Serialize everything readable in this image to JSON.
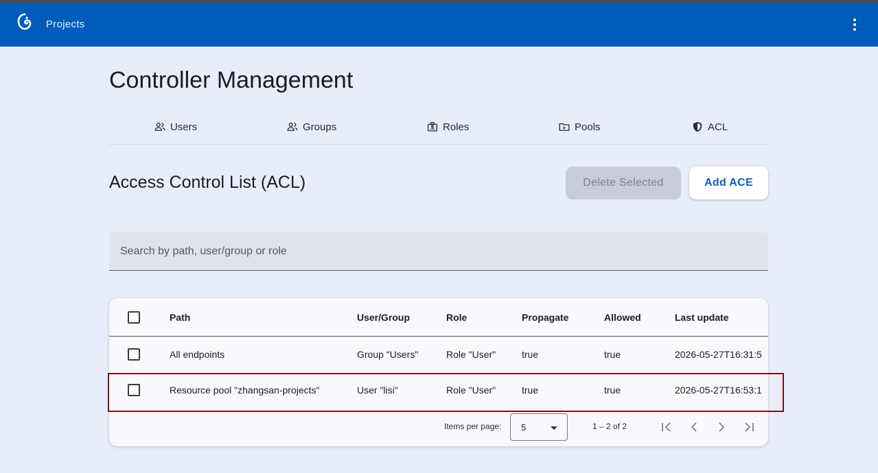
{
  "appbar": {
    "title": "Projects"
  },
  "page": {
    "title": "Controller Management"
  },
  "tabs": [
    {
      "label": "Users",
      "icon": "users-icon"
    },
    {
      "label": "Groups",
      "icon": "groups-icon"
    },
    {
      "label": "Roles",
      "icon": "roles-icon"
    },
    {
      "label": "Pools",
      "icon": "pools-icon"
    },
    {
      "label": "ACL",
      "icon": "shield-icon"
    }
  ],
  "section": {
    "title": "Access Control List (ACL)",
    "delete_label": "Delete Selected",
    "add_label": "Add ACE"
  },
  "search": {
    "placeholder": "Search by path, user/group or role"
  },
  "table": {
    "columns": [
      "Path",
      "User/Group",
      "Role",
      "Propagate",
      "Allowed",
      "Last update"
    ],
    "rows": [
      {
        "path": "All endpoints",
        "user_group": "Group \"Users\"",
        "role": "Role \"User\"",
        "propagate": "true",
        "allowed": "true",
        "last_update": "2026-05-27T16:31:5"
      },
      {
        "path": "Resource pool \"zhangsan-projects\"",
        "user_group": "User \"lisi\"",
        "role": "Role \"User\"",
        "propagate": "true",
        "allowed": "true",
        "last_update": "2026-05-27T16:53:1"
      }
    ]
  },
  "paginator": {
    "items_per_page_label": "Items per page:",
    "page_size": "5",
    "range_label": "1 – 2 of 2"
  },
  "colors": {
    "appbar": "#005cbb",
    "background": "#e8edfa",
    "highlight": "#7a0f16",
    "accent": "#0b5fb8"
  }
}
